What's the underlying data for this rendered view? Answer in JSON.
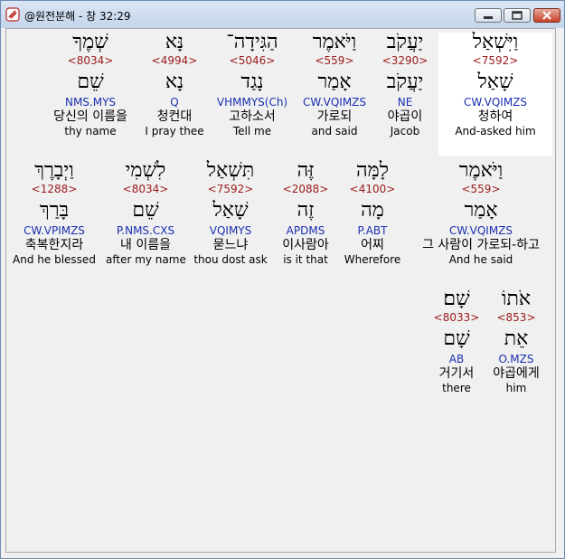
{
  "window": {
    "title": "@원전분해 - 창 32:29"
  },
  "row1": [
    {
      "hebrew": "וַיִּשְׁאַל",
      "strong": "<7592>",
      "lemma": "שָׁאַל",
      "morph": "CW.VQIMZS",
      "korean": "청하여",
      "english": "And-asked him"
    },
    {
      "hebrew": "יַעֲקֹב",
      "strong": "<3290>",
      "lemma": "יַעֲקֹב",
      "morph": "NE",
      "korean": "야곱이",
      "english": "Jacob"
    },
    {
      "hebrew": "וַיֹּאמֶר",
      "strong": "<559>",
      "lemma": "אָמַר",
      "morph": "CW.VQIMZS",
      "korean": "가로되",
      "english": "and said"
    },
    {
      "hebrew": "הַגִּידָה־",
      "strong": "<5046>",
      "lemma": "נָגַד",
      "morph": "VHMMYS(Ch)",
      "korean": "고하소서",
      "english": "Tell me"
    },
    {
      "hebrew": "נָּא",
      "strong": "<4994>",
      "lemma": "נָא",
      "morph": "Q",
      "korean": "청컨대",
      "english": "I pray thee"
    },
    {
      "hebrew": "שְׁמֶךָ",
      "strong": "<8034>",
      "lemma": "שֵׁם",
      "morph": "NMS.MYS",
      "korean": "당신의 이름을",
      "english": "thy name"
    }
  ],
  "row2": [
    {
      "hebrew": "וַיֹּאמֶר",
      "strong": "<559>",
      "lemma": "אָמַר",
      "morph": "CW.VQIMZS",
      "korean": "그 사람이 가로되-하고",
      "english": "And he said"
    },
    {
      "hebrew": "לָמָּה",
      "strong": "<4100>",
      "lemma": "מָה",
      "morph": "P.ABT",
      "korean": "어찌",
      "english": "Wherefore"
    },
    {
      "hebrew": "זֶּה",
      "strong": "<2088>",
      "lemma": "זֶה",
      "morph": "APDMS",
      "korean": "이사람아",
      "english": "is it that"
    },
    {
      "hebrew": "תִּשְׁאַל",
      "strong": "<7592>",
      "lemma": "שָׁאַל",
      "morph": "VQIMYS",
      "korean": "묻느냐",
      "english": "thou dost ask"
    },
    {
      "hebrew": "לִשְׁמִי",
      "strong": "<8034>",
      "lemma": "שֵׁם",
      "morph": "P.NMS.CXS",
      "korean": "내 이름을",
      "english": "after my name"
    },
    {
      "hebrew": "וַיְבָרֶךְ",
      "strong": "<1288>",
      "lemma": "בָּרַךְ",
      "morph": "CW.VPIMZS",
      "korean": "축복한지라",
      "english": "And he blessed"
    }
  ],
  "row3": [
    {
      "hebrew": "אֹתוֹ",
      "strong": "<853>",
      "lemma": "אֵת",
      "morph": "O.MZS",
      "korean": "야곱에게",
      "english": "him"
    },
    {
      "hebrew": "שָׁם׃",
      "strong": "<8033>",
      "lemma": "שָׁם",
      "morph": "AB",
      "korean": "거기서",
      "english": "there"
    }
  ]
}
